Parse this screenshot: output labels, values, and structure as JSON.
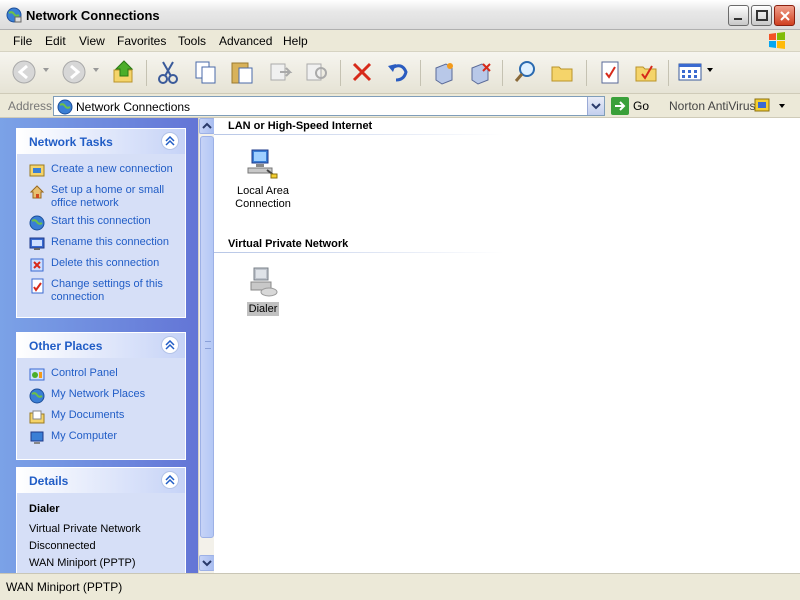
{
  "window": {
    "title": "Network Connections"
  },
  "menu": {
    "items": [
      "File",
      "Edit",
      "View",
      "Favorites",
      "Tools",
      "Advanced",
      "Help"
    ]
  },
  "address": {
    "label": "Address",
    "value": "Network Connections",
    "go_label": "Go",
    "norton_label": "Norton AntiVirus"
  },
  "network_tasks": {
    "title": "Network Tasks",
    "items": [
      {
        "label": "Create a new connection",
        "icon": "new-connection-icon"
      },
      {
        "label": "Set up a home or small office network",
        "icon": "home-network-icon"
      },
      {
        "label": "Start this connection",
        "icon": "start-connection-icon"
      },
      {
        "label": "Rename this connection",
        "icon": "rename-icon"
      },
      {
        "label": "Delete this connection",
        "icon": "delete-icon"
      },
      {
        "label": "Change settings of this connection",
        "icon": "settings-icon"
      }
    ]
  },
  "other_places": {
    "title": "Other Places",
    "items": [
      {
        "label": "Control Panel",
        "icon": "control-panel-icon"
      },
      {
        "label": "My Network Places",
        "icon": "network-places-icon"
      },
      {
        "label": "My Documents",
        "icon": "documents-icon"
      },
      {
        "label": "My Computer",
        "icon": "computer-icon"
      }
    ]
  },
  "details": {
    "title": "Details",
    "name": "Dialer",
    "lines": [
      "Virtual Private Network",
      "Disconnected",
      "WAN Miniport (PPTP)"
    ]
  },
  "groups": [
    {
      "title": "LAN or High-Speed Internet",
      "items": [
        {
          "label_line1": "Local Area",
          "label_line2": "Connection"
        }
      ]
    },
    {
      "title": "Virtual Private Network",
      "items": [
        {
          "label_line1": "Dialer",
          "label_line2": ""
        }
      ]
    }
  ],
  "status": {
    "text": "WAN Miniport (PPTP)"
  },
  "colors": {
    "task_link": "#215dc6",
    "panel_gradient_start": "#7ba2e7",
    "panel_gradient_end": "#6375d6"
  }
}
